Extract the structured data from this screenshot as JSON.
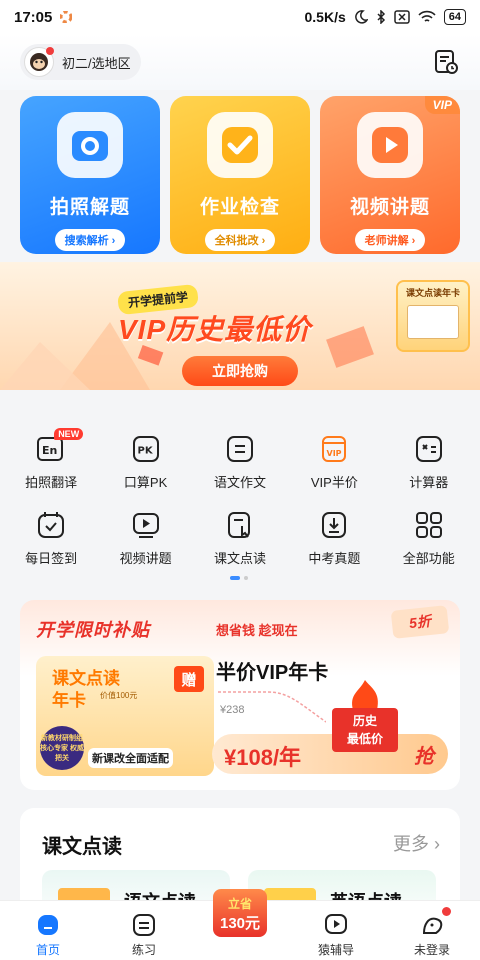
{
  "status_bar": {
    "time": "17:05",
    "network": "0.5K/s",
    "battery": "64"
  },
  "header": {
    "grade_label": "初二/选地区"
  },
  "feature_cards": [
    {
      "title": "拍照解题",
      "sub": "搜索解析 ›"
    },
    {
      "title": "作业检查",
      "sub": "全科批改 ›"
    },
    {
      "title": "视频讲题",
      "sub": "老师讲解 ›",
      "badge": "VIP"
    }
  ],
  "banner": {
    "tag": "开学提前学",
    "headline": "VIP历史最低价",
    "cta": "立即抢购",
    "card_label": "课文点读年卡",
    "card_gift": "赠"
  },
  "grid_items": [
    {
      "label": "拍照翻译",
      "icon": "translate-icon",
      "badge": "NEW"
    },
    {
      "label": "口算PK",
      "icon": "pk-icon"
    },
    {
      "label": "语文作文",
      "icon": "essay-icon"
    },
    {
      "label": "VIP半价",
      "icon": "vip-half-icon"
    },
    {
      "label": "计算器",
      "icon": "calculator-icon"
    },
    {
      "label": "每日签到",
      "icon": "checkin-icon"
    },
    {
      "label": "视频讲题",
      "icon": "video-icon"
    },
    {
      "label": "课文点读",
      "icon": "read-icon"
    },
    {
      "label": "中考真题",
      "icon": "exam-icon"
    },
    {
      "label": "全部功能",
      "icon": "all-features-icon"
    }
  ],
  "promo": {
    "heading": "开学限时补贴",
    "subheading": "想省钱 趁现在",
    "discount": "5折",
    "left_title_1": "课文点读",
    "left_title_2": "年卡",
    "left_value": "价值100元",
    "gift": "赠",
    "seal": "新教材研制组 核心专家 权威把关",
    "left_footer": "新课改全面适配",
    "product_title": "半价VIP年卡",
    "old_price": "¥238",
    "price": "¥108/年",
    "lowest_1": "历史",
    "lowest_2": "最低价",
    "grab": "抢"
  },
  "section": {
    "title": "课文点读",
    "more": "更多 ›",
    "cards": [
      "语文点读",
      "英语点读"
    ]
  },
  "tabbar": [
    {
      "label": "首页",
      "icon": "home-icon",
      "active": true
    },
    {
      "label": "练习",
      "icon": "practice-icon"
    },
    {
      "label": "",
      "icon": "savings-badge",
      "badge_top": "立省",
      "badge_bottom": "130元"
    },
    {
      "label": "猿辅导",
      "icon": "tutoring-icon"
    },
    {
      "label": "未登录",
      "icon": "profile-icon"
    }
  ],
  "colors": {
    "primary": "#1677ff",
    "accent_red": "#e8322a",
    "orange": "#ff6a2c",
    "yellow": "#ffae12"
  }
}
